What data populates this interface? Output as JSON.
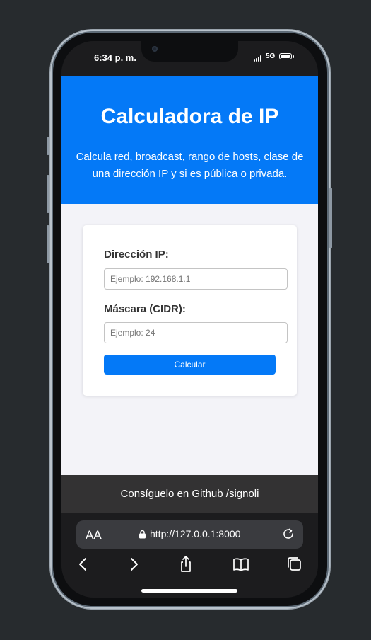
{
  "status_bar": {
    "time": "6:34 p. m.",
    "network": "5G"
  },
  "header": {
    "title": "Calculadora de IP",
    "description": "Calcula red, broadcast, rango de hosts, clase de una dirección IP y si es pública o privada."
  },
  "form": {
    "ip_label": "Dirección IP:",
    "ip_placeholder": "Ejemplo: 192.168.1.1",
    "mask_label": "Máscara (CIDR):",
    "mask_placeholder": "Ejemplo: 24",
    "submit_label": "Calcular"
  },
  "footer": {
    "text": "Consíguelo en Github /signoli"
  },
  "browser": {
    "text_size_label": "AA",
    "url": "http://127.0.0.1:8000",
    "icons": [
      "back-icon",
      "forward-icon",
      "share-icon",
      "bookmarks-icon",
      "tabs-icon"
    ]
  },
  "colors": {
    "primary": "#0479f7",
    "footer_bg": "#333233",
    "page_bg": "#f3f3f8"
  }
}
